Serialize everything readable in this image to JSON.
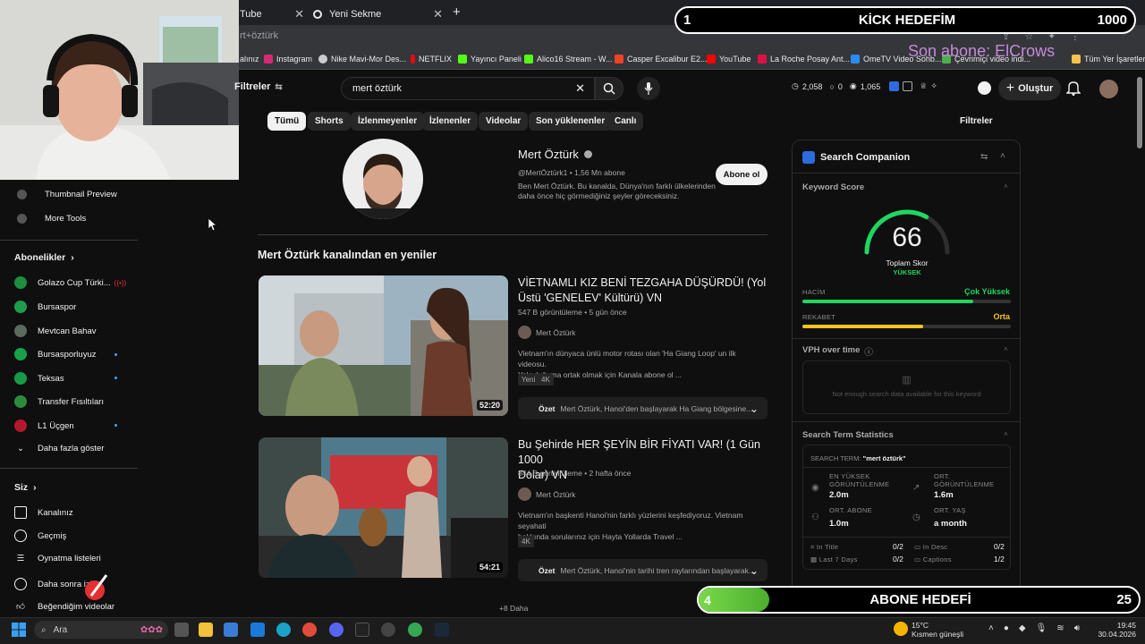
{
  "browser": {
    "tabs": [
      {
        "label": "Tube"
      },
      {
        "label": "Yeni Sekme"
      }
    ],
    "new_tab_glyph": "+",
    "address": "rt+öztürk",
    "bookmarks": [
      "alınız",
      "Instagram",
      "Nike Mavi-Mor Des...",
      "NETFLIX",
      "Yayıncı Paneli",
      "Alico16 Stream - W...",
      "Casper Excalibur E2...",
      "YouTube",
      "La Roche Posay Ant...",
      "OmeTV Video Sohb...",
      "Çevrimiçi video indi...",
      "Tüm Yer İşaretleri"
    ],
    "bookmark_colors": [
      "#bbb",
      "#d62976",
      "#ccc",
      "#e50914",
      "#53fc18",
      "#53fc18",
      "#ef4123",
      "#ff0000",
      "#d14",
      "#2a8bf2",
      "#4caf50",
      "#f5c24c"
    ]
  },
  "overlay": {
    "kick_goal": {
      "current": "1",
      "title": "KİCK HEDEFİM",
      "target": "1000"
    },
    "last_sub": "Son abone: ElCrows",
    "sub_goal": {
      "current": "4",
      "title": "ABONE HEDEFİ",
      "target": "25",
      "progress": 0.16
    }
  },
  "youtube": {
    "filters_label": "Filtreler",
    "search_value": "mert öztürk",
    "stats": {
      "a": "2,058",
      "b": "0",
      "c": "1,065"
    },
    "create_label": "Oluştur",
    "chips": [
      "Tümü",
      "Shorts",
      "İzlenmeyenler",
      "İzlenenler",
      "Videolar",
      "Son yüklenenler",
      "Canlı"
    ],
    "right_filters": "Filtreler",
    "sidebar": {
      "tools": [
        "Thumbnail Preview",
        "More Tools"
      ],
      "subs_header": "Abonelikler",
      "subs": [
        {
          "name": "Golazo Cup Türki...",
          "color": "#1e8f3e"
        },
        {
          "name": "Bursaspor",
          "color": "#1e9e4a"
        },
        {
          "name": "Mevtcan Bahav",
          "color": "#5a6b5d"
        },
        {
          "name": "Bursasporluyuz",
          "color": "#17a14b"
        },
        {
          "name": "Teksas",
          "color": "#189b48"
        },
        {
          "name": "Transfer Fısıltıları",
          "color": "#2c8c3c"
        },
        {
          "name": "L1 Üçgen",
          "color": "#b5182b"
        }
      ],
      "show_more": "Daha fazla göster",
      "you_header": "Siz",
      "you_items": [
        "Kanalınız",
        "Geçmiş",
        "Oynatma listeleri",
        "Daha sonra izle",
        "Beğendiğim videolar"
      ]
    },
    "channel": {
      "name": "Mert Öztürk",
      "handle_subs": "@MertÖztürk1 • 1,56 Mn abone",
      "desc_1": "Ben Mert Öztürk. Bu kanalda, Dünya'nın farklı ülkelerinden",
      "desc_2": "daha önce hiç görmediğiniz şeyler göreceksiniz.",
      "subscribe": "Abone ol"
    },
    "section_title": "Mert Öztürk kanalından en yeniler",
    "videos": [
      {
        "title_1": "VİETNAMLI KIZ BENİ TEZGAHA DÜŞÜRDÜ! (Yol",
        "title_2": "Üstü 'GENELEV' Kültürü) VN",
        "meta": "547 B görüntüleme • 5 gün önce",
        "channel": "Mert Öztürk",
        "desc_1": "Vietnam'ın dünyaca ünlü motor rotası olan 'Ha Giang Loop' un ilk videosu.",
        "desc_2": "Yolculuğuma ortak olmak için Kanala abone ol ...",
        "badges": [
          "Yeni",
          "4K"
        ],
        "duration": "52:20",
        "summary_label": "Özet",
        "summary": "Mert Öztürk, Hanoi'den başlayarak Ha Giang bölgesine..."
      },
      {
        "title_1": "Bu Şehirde HER ŞEYİN BİR FİYATI VAR! (1 Gün 1000",
        "title_2": "Dolar) VN",
        "meta": "844 B görüntüleme • 2 hafta önce",
        "channel": "Mert Öztürk",
        "desc_1": "Vietnam'ın başkenti Hanoi'nin farklı yüzlerini keşfediyoruz. Vietnam seyahati",
        "desc_2": "hakkında sorularınız için Hayta Yollarda Travel ...",
        "badges": [
          "4K"
        ],
        "duration": "54:21",
        "summary_label": "Özet",
        "summary": "Mert Öztürk, Hanoi'nin tarihi tren raylarından başlayarak..."
      }
    ],
    "more": "+8 Daha"
  },
  "companion": {
    "title": "Search Companion",
    "keyword_score": "Keyword Score",
    "score": "66",
    "score_label": "Toplam Skor",
    "score_level": "YÜKSEK",
    "score_fraction": 0.66,
    "hacim_label": "HACİM",
    "hacim_value": "Çok Yüksek",
    "hacim_fraction": 0.82,
    "rekabet_label": "REKABET",
    "rekabet_value": "Orta",
    "rekabet_fraction": 0.58,
    "vph_title": "VPH over time",
    "vph_empty": "Not enough search data available for this keyword",
    "stats_title": "Search Term Statistics",
    "search_term_label": "SEARCH TERM:",
    "search_term": "\"mert öztürk\"",
    "en_yuksek_1": "EN YÜKSEK",
    "en_yuksek_2": "GÖRÜNTÜLENME",
    "en_yuksek_value": "2.0m",
    "ort_gor_1": "ORT.",
    "ort_gor_2": "GÖRÜNTÜLENME",
    "ort_gor_value": "1.6m",
    "ort_abone_1": "ORT. ABONE",
    "ort_abone_value": "1.0m",
    "ort_yas_1": "ORT. YAŞ",
    "ort_yas_value": "a month",
    "in_title": "In Title",
    "in_title_v": "0/2",
    "in_desc": "In Desc",
    "in_desc_v": "0/2",
    "last7": "Last 7 Days",
    "last7_v": "0/2",
    "captions": "Captions",
    "captions_v": "1/2",
    "colors": {
      "accent": "#1ed760",
      "medium": "#f5c518",
      "blue": "#3ea6ff"
    }
  },
  "taskbar": {
    "search": "Ara",
    "weather_temp": "15°C",
    "weather_desc": "Kısmen güneşli",
    "time": "19:45",
    "date": "30.04.2026"
  }
}
